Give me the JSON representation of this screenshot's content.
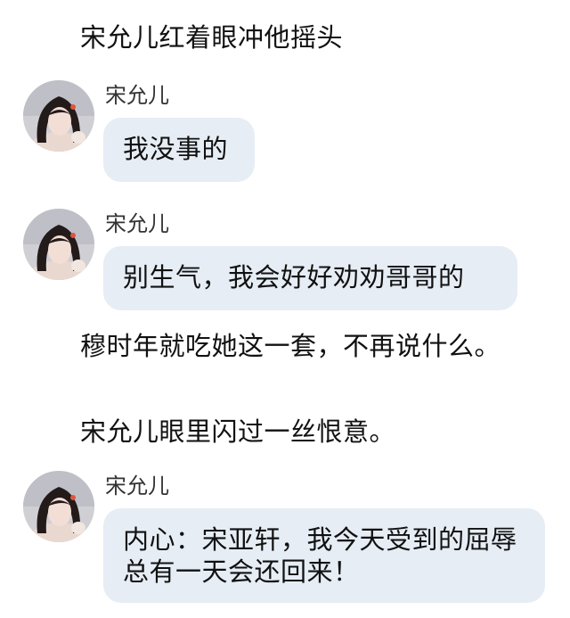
{
  "narration": [
    "宋允儿红着眼冲他摇头",
    "穆时年就吃她这一套，不再说什么。",
    "宋允儿眼里闪过一丝恨意。"
  ],
  "messages": [
    {
      "sender": "宋允儿",
      "text": "我没事的"
    },
    {
      "sender": "宋允儿",
      "text": "别生气，我会好好劝劝哥哥的"
    },
    {
      "sender": "宋允儿",
      "text": "内心：宋亚轩，我今天受到的屈辱总有一天会还回来！"
    }
  ],
  "colors": {
    "bubble": "#e6edf5",
    "text": "#111111"
  }
}
